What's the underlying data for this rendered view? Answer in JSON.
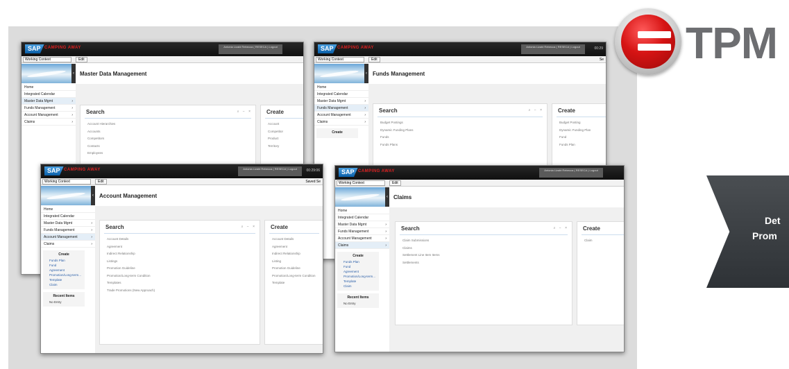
{
  "badge": {
    "title": "TPM",
    "accent": "#d61414"
  },
  "chevron": {
    "line1": "Det",
    "line2": "Prom",
    "color": "#3a3e42"
  },
  "common": {
    "brand": "CAMPING AWAY",
    "context_placeholder": "Working Context",
    "edit_label": "Edit",
    "user_text": "Antonia Lizabi Rebecca ( RESECA ) Logout",
    "nav": [
      {
        "label": "Home",
        "arrow": ""
      },
      {
        "label": "Integrated Calendar",
        "arrow": ""
      },
      {
        "label": "Master Data Mgmt",
        "arrow": "›"
      },
      {
        "label": "Funds Management",
        "arrow": "›"
      },
      {
        "label": "Account Management",
        "arrow": "›"
      },
      {
        "label": "Claims",
        "arrow": "›"
      }
    ],
    "create_title": "Create",
    "create_links": [
      "Funds Plan",
      "Fund",
      "Agreement",
      "Promotion/Long-term...",
      "Template",
      "Claim"
    ],
    "recent_title": "Recent Items",
    "recent_empty": "No Entry",
    "search_title": "Search",
    "create_panel_title": "Create",
    "panel_tools": "⌕ − ×"
  },
  "screens": [
    {
      "title": "Master Data Management",
      "clock": "",
      "ctx_right": "",
      "search_links": [
        "Account Hierarchies",
        "Accounts",
        "Competitors",
        "Contacts",
        "Employees"
      ],
      "create_links": [
        "Account",
        "Competitor",
        "Product",
        "Territory"
      ]
    },
    {
      "title": "Funds Management",
      "clock": "00:29",
      "ctx_right": "Se",
      "search_links": [
        "Budget Postings",
        "Dynamic Funding Plans",
        "Funds",
        "Funds Plans"
      ],
      "create_links": [
        "Budget Posting",
        "Dynamic Funding Plan",
        "Fund",
        "Funds Plan"
      ]
    },
    {
      "title": "Account Management",
      "clock": "00:29:06",
      "ctx_right": "Saved Se",
      "search_links": [
        "Account Details",
        "Agreement",
        "Indirect Relationship",
        "Listings",
        "Promotion Guideline",
        "Promotion/Long-term Condition",
        "Templates",
        "Trade Promotions (New Approach)"
      ],
      "create_links": [
        "Account Details",
        "Agreement",
        "Indirect Relationship",
        "Listing",
        "Promotion Guideline",
        "Promotion/Long-term Condition",
        "Template"
      ]
    },
    {
      "title": "Claims",
      "clock": "",
      "ctx_right": "",
      "search_links": [
        "Claim Submissions",
        "Claims",
        "Settlement Line Item Items",
        "Settlements"
      ],
      "create_links": [
        "Claim"
      ]
    }
  ]
}
